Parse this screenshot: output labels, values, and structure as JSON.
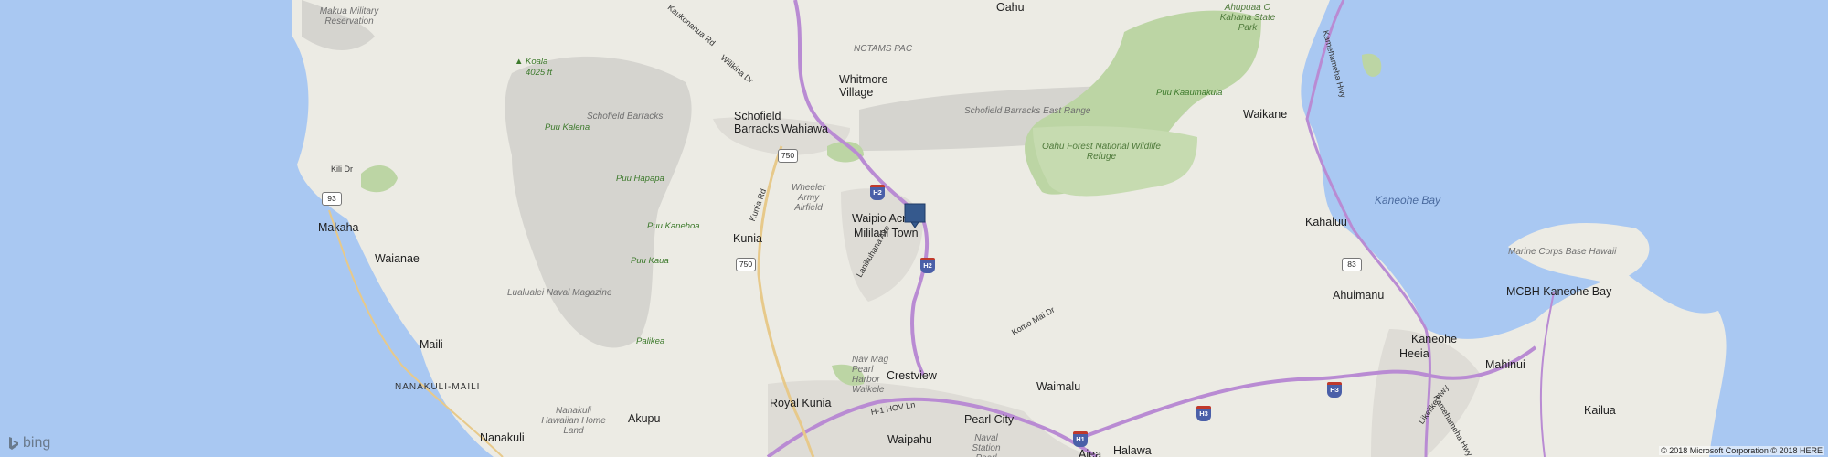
{
  "map": {
    "provider_logo": "bing",
    "copyright": "© 2018 Microsoft Corporation © 2018 HERE",
    "pin_icon": "location-pin-icon",
    "places": {
      "makua": "Makua Military Reservation",
      "koala": "Koala",
      "koala_ft": "4025 ft",
      "oahu": "Oahu",
      "ahupuaa": "Ahupuaa O Kahana State Park",
      "kamehameha": "Kamehameha Hwy",
      "kaukonahua": "Kaukonahua Rd",
      "wilikina": "Wilikina Dr",
      "nctams": "NCTAMS PAC",
      "whitmore": "Whitmore Village",
      "schofield": "Schofield Barracks",
      "wahiawa": "Wahiawa",
      "schofield_mil": "Schofield Barracks",
      "schofield_east": "Schofield Barracks East Range",
      "puu_kaaumakula": "Puu Kaaumakula",
      "waikane": "Waikane",
      "puu_kalena": "Puu Kalena",
      "oahu_forest": "Oahu Forest National Wildlife Refuge",
      "kili": "Kili Dr",
      "wheeler": "Wheeler Army Airfield",
      "puu_hapapa": "Puu Hapapa",
      "waipio": "Waipio Acres",
      "mililani": "Mililani Town",
      "kaneohe_bay": "Kaneohe Bay",
      "kahaluu": "Kahaluu",
      "makaha": "Makaha",
      "puu_kanehoa": "Puu Kanehoa",
      "kunia_rd": "Kunia Rd",
      "kunia": "Kunia",
      "marine": "Marine Corps Base Hawaii",
      "waianae": "Waianae",
      "puu_kaua": "Puu Kaua",
      "lanikuhana": "Lanikuhana Ave",
      "lualualei": "Lualualei Naval Magazine",
      "ahuimanu": "Ahuimanu",
      "mcbh": "MCBH Kaneohe Bay",
      "komo": "Komo Mai Dr",
      "maili": "Maili",
      "palikea": "Palikea",
      "kaneohe": "Kaneohe",
      "heeia": "Heeia",
      "mahinui": "Mahinui",
      "nanakuli_maili": "NANAKULI-MAILI",
      "navmag": "Nav Mag Pearl Harbor Waikele",
      "crestview": "Crestview",
      "waimalu": "Waimalu",
      "likelike": "Likelike Hwy",
      "kamehameha2": "Kamehameha Hwy",
      "kailua": "Kailua",
      "nanakuli_home": "Nanakuli Hawaiian Home Land",
      "akupu": "Akupu",
      "royal_kunia": "Royal Kunia",
      "hov": "H-1 HOV Ln",
      "pearl_city": "Pearl City",
      "nanakuli": "Nanakuli",
      "waipahu": "Waipahu",
      "naval_station": "Naval Station Pearl",
      "aiea": "Aiea",
      "halawa": "Halawa"
    },
    "shields": {
      "r750a": "750",
      "r750b": "750",
      "r93": "93",
      "r83": "83",
      "h2a": "H2",
      "h2b": "H2",
      "h3a": "H3",
      "h3b": "H3",
      "h1": "H1"
    },
    "colors": {
      "ocean": "#a9c8f2",
      "land": "#ecebe4",
      "mountain": "#d5d4cf",
      "park": "#bcd5a4",
      "interstate": "#b98bd3",
      "route": "#f2d9a3",
      "urban": "#dedcd6"
    }
  }
}
